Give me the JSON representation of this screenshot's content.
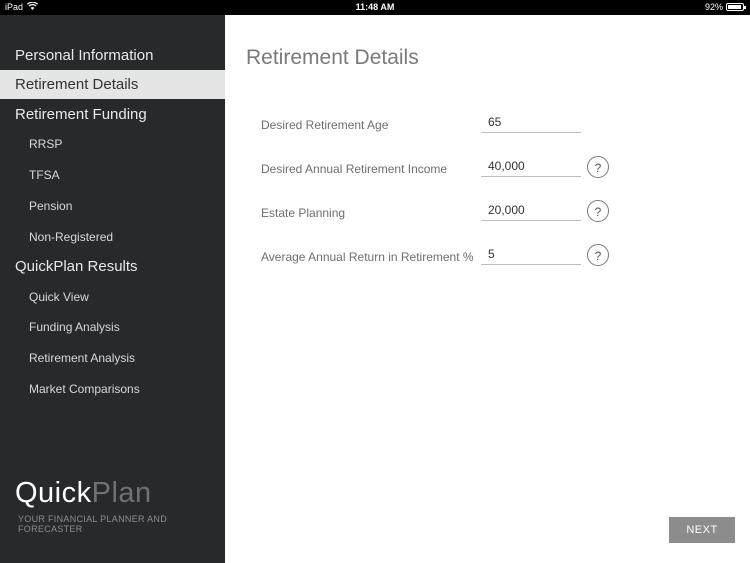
{
  "status_bar": {
    "device": "iPad",
    "time": "11:48 AM",
    "battery": "92%",
    "battery_level": 0.92,
    "wifi_icon": "wifi-icon",
    "battery_icon": "battery-icon"
  },
  "sidebar": {
    "items": [
      {
        "label": "Personal Information",
        "level": "top",
        "active": false
      },
      {
        "label": "Retirement Details",
        "level": "top",
        "active": true
      },
      {
        "label": "Retirement Funding",
        "level": "top",
        "active": false
      },
      {
        "label": "RRSP",
        "level": "sub",
        "active": false
      },
      {
        "label": "TFSA",
        "level": "sub",
        "active": false
      },
      {
        "label": "Pension",
        "level": "sub",
        "active": false
      },
      {
        "label": "Non-Registered",
        "level": "sub",
        "active": false
      },
      {
        "label": "QuickPlan Results",
        "level": "top",
        "active": false
      },
      {
        "label": "Quick View",
        "level": "sub",
        "active": false
      },
      {
        "label": "Funding Analysis",
        "level": "sub",
        "active": false
      },
      {
        "label": "Retirement Analysis",
        "level": "sub",
        "active": false
      },
      {
        "label": "Market Comparisons",
        "level": "sub",
        "active": false
      }
    ],
    "brand_bold": "Quick",
    "brand_light": "Plan",
    "tagline": "YOUR FINANCIAL PLANNER AND FORECASTER"
  },
  "main": {
    "title": "Retirement Details",
    "fields": [
      {
        "label": "Desired Retirement Age",
        "value": "65",
        "help": null
      },
      {
        "label": "Desired Annual Retirement Income",
        "value": "40,000",
        "help": "?"
      },
      {
        "label": "Estate Planning",
        "value": "20,000",
        "help": "?"
      },
      {
        "label": "Average Annual Return in Retirement %",
        "value": "5",
        "help": "?"
      }
    ],
    "next_label": "NEXT"
  },
  "colors": {
    "sidebar_bg": "#262a2b",
    "active_item_bg": "#e5e5e5",
    "next_button_bg": "#8c8c8c"
  }
}
